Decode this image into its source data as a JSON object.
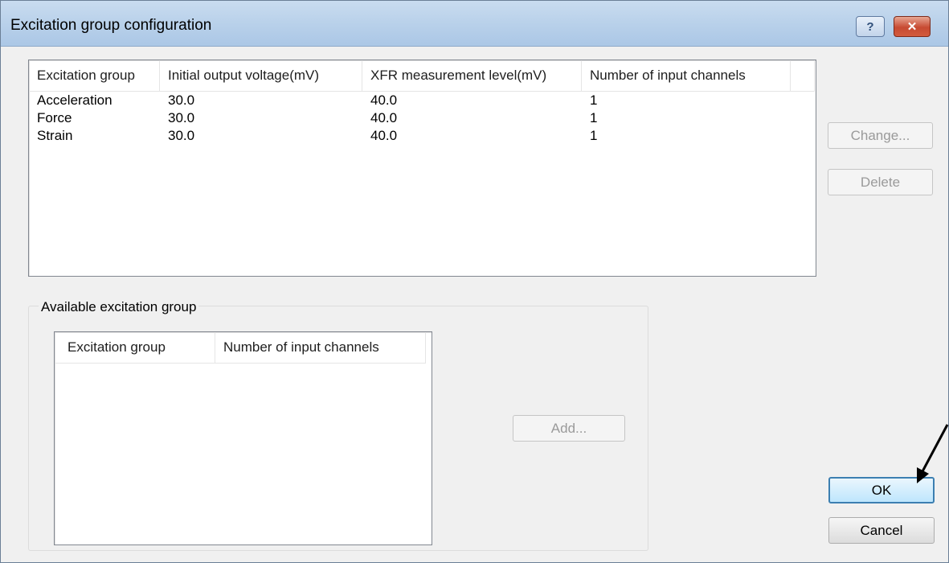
{
  "window": {
    "title": "Excitation group configuration",
    "help_glyph": "?",
    "close_glyph": "✕"
  },
  "groups_table": {
    "columns": [
      "Excitation group",
      "Initial output voltage(mV)",
      "XFR measurement level(mV)",
      "Number of input channels"
    ],
    "rows": [
      [
        "Acceleration",
        "30.0",
        "40.0",
        "1"
      ],
      [
        "Force",
        "30.0",
        "40.0",
        "1"
      ],
      [
        "Strain",
        "30.0",
        "40.0",
        "1"
      ]
    ]
  },
  "side_buttons": {
    "change_label": "Change...",
    "delete_label": "Delete"
  },
  "available": {
    "group_label": "Available excitation group",
    "columns": [
      "Excitation group",
      "Number of input channels"
    ],
    "add_label": "Add..."
  },
  "footer": {
    "ok_label": "OK",
    "cancel_label": "Cancel"
  },
  "colors": {
    "titlebar": "#b9d1ea",
    "close_button": "#c74a32",
    "default_button_border": "#3c7fb1"
  }
}
